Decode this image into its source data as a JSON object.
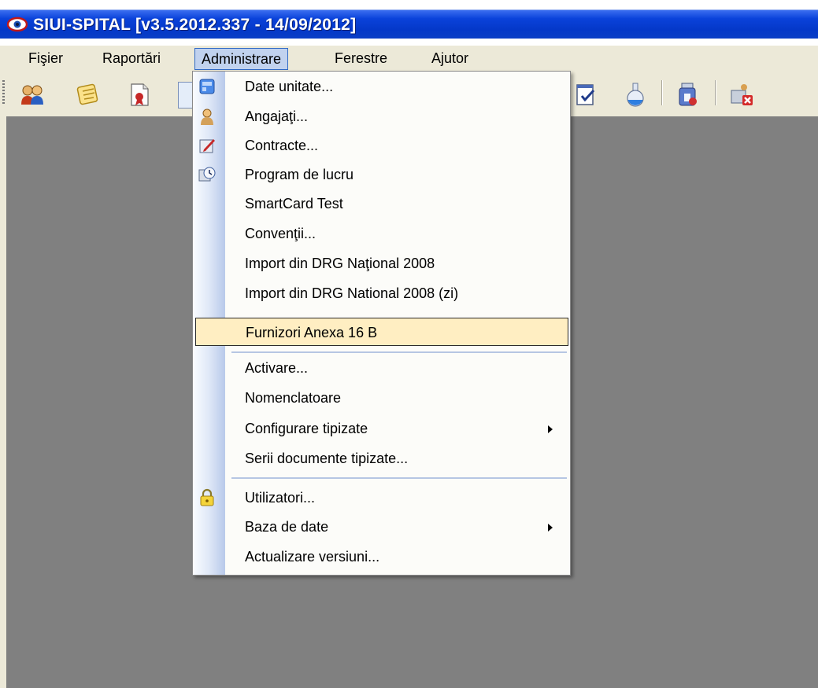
{
  "window": {
    "title": "SIUI-SPITAL [v3.5.2012.337 - 14/09/2012]",
    "app_icon": "eye-logo-icon"
  },
  "menubar": {
    "items": [
      {
        "label": "Fişier"
      },
      {
        "label": "Raportări"
      },
      {
        "label": "Administrare",
        "active": true
      },
      {
        "label": "Ferestre"
      },
      {
        "label": "Ajutor"
      }
    ]
  },
  "toolbar": {
    "icons": [
      "users-icon",
      "notes-icon",
      "certificate-document-icon",
      "document-icon",
      "checklist-icon",
      "flask-icon",
      "medical-kit-icon",
      "close-record-icon"
    ]
  },
  "dropdown": {
    "items": [
      {
        "label": "Date unitate...",
        "icon": "unit-data-icon"
      },
      {
        "label": "Angajaţi...",
        "icon": "employee-icon"
      },
      {
        "label": "Contracte...",
        "icon": "contract-edit-icon"
      },
      {
        "label": "Program de lucru",
        "icon": "work-schedule-icon"
      },
      {
        "label": "SmartCard Test"
      },
      {
        "label": "Convenţii..."
      },
      {
        "label": "Import din DRG Naţional 2008"
      },
      {
        "label": "Import din DRG National 2008 (zi)"
      },
      {
        "label": "Furnizori Anexa 16 B",
        "highlighted": true
      },
      {
        "label": "Activare..."
      },
      {
        "label": "Nomenclatoare"
      },
      {
        "label": "Configurare tipizate",
        "submenu": true
      },
      {
        "label": "Serii documente tipizate..."
      },
      {
        "label": "Utilizatori...",
        "icon": "lock-icon"
      },
      {
        "label": "Baza de date",
        "submenu": true
      },
      {
        "label": "Actualizare versiuni..."
      }
    ]
  },
  "colors": {
    "title_bar": "#0a42da",
    "menu_bg": "#ece9d8",
    "workspace": "#808080",
    "highlight": "#ffeec2"
  }
}
